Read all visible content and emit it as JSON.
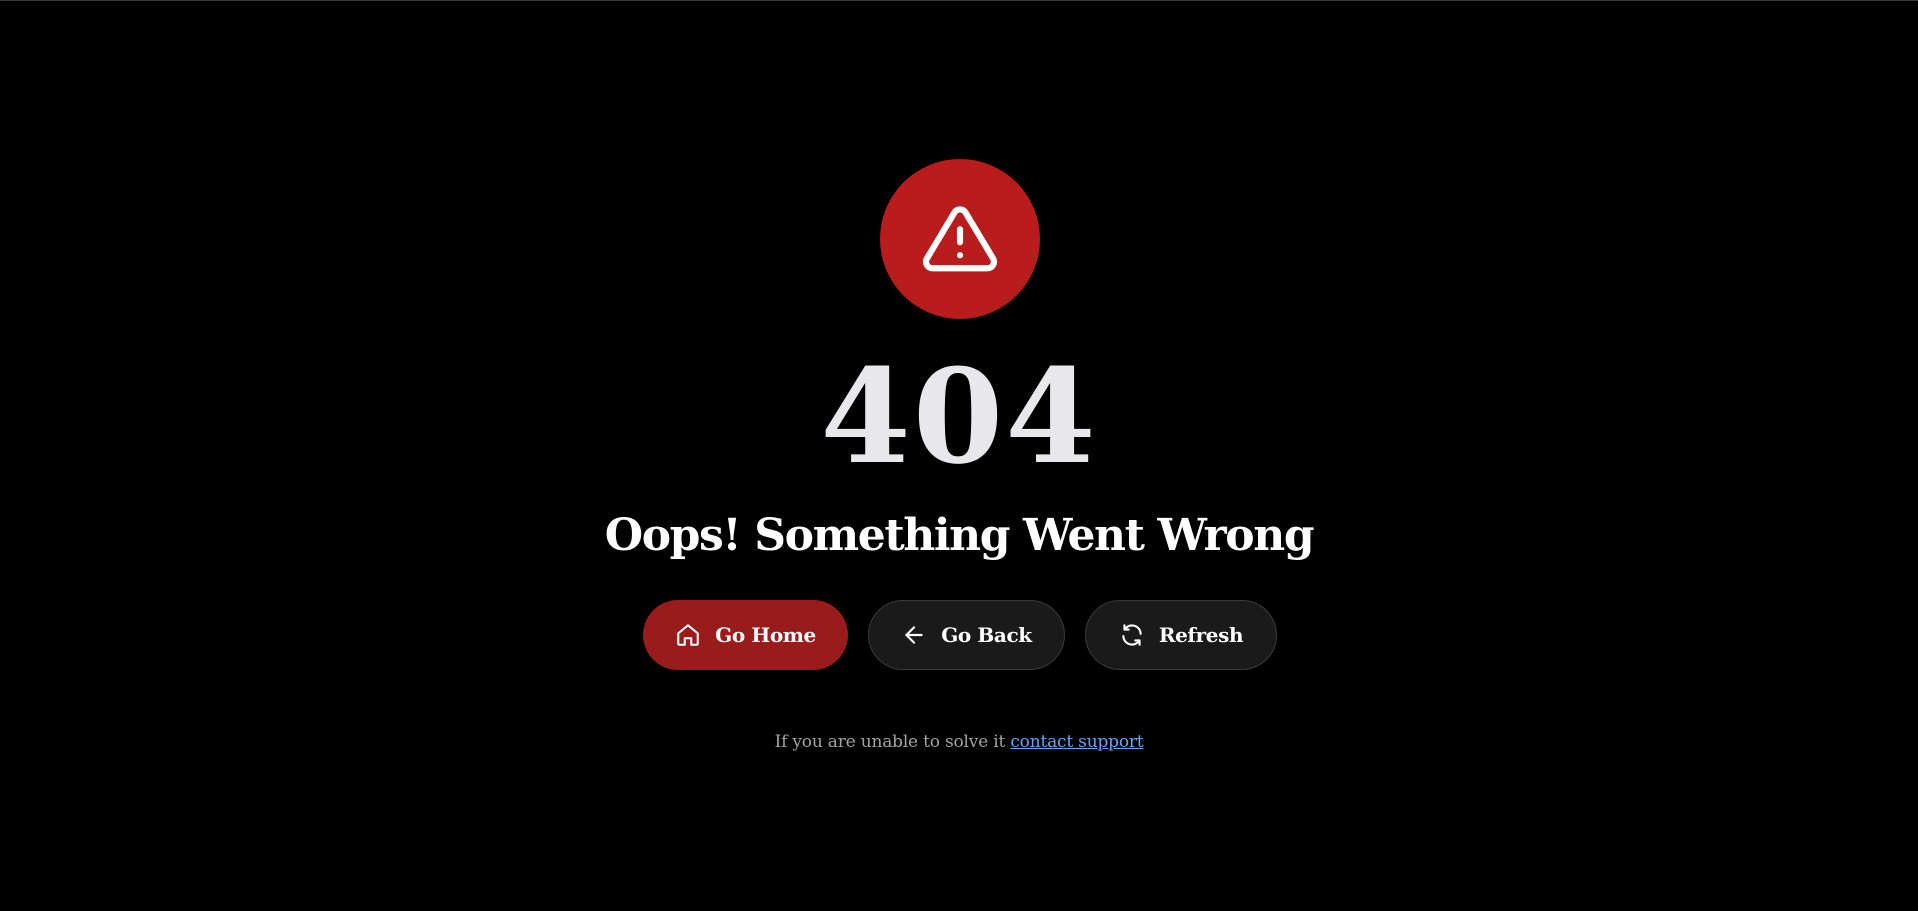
{
  "error": {
    "code": "404",
    "headline": "Oops! Something Went Wrong",
    "icon": "warning-triangle-icon"
  },
  "actions": {
    "home_label": "Go Home",
    "back_label": "Go Back",
    "refresh_label": "Refresh"
  },
  "help": {
    "text": "If you are unable to solve it",
    "link_label": "contact support"
  },
  "colors": {
    "background": "#000000",
    "alert": "#b91c1c",
    "primary_button": "#991b1b",
    "secondary_button": "#1a1a1a",
    "link": "#60a5fa"
  }
}
